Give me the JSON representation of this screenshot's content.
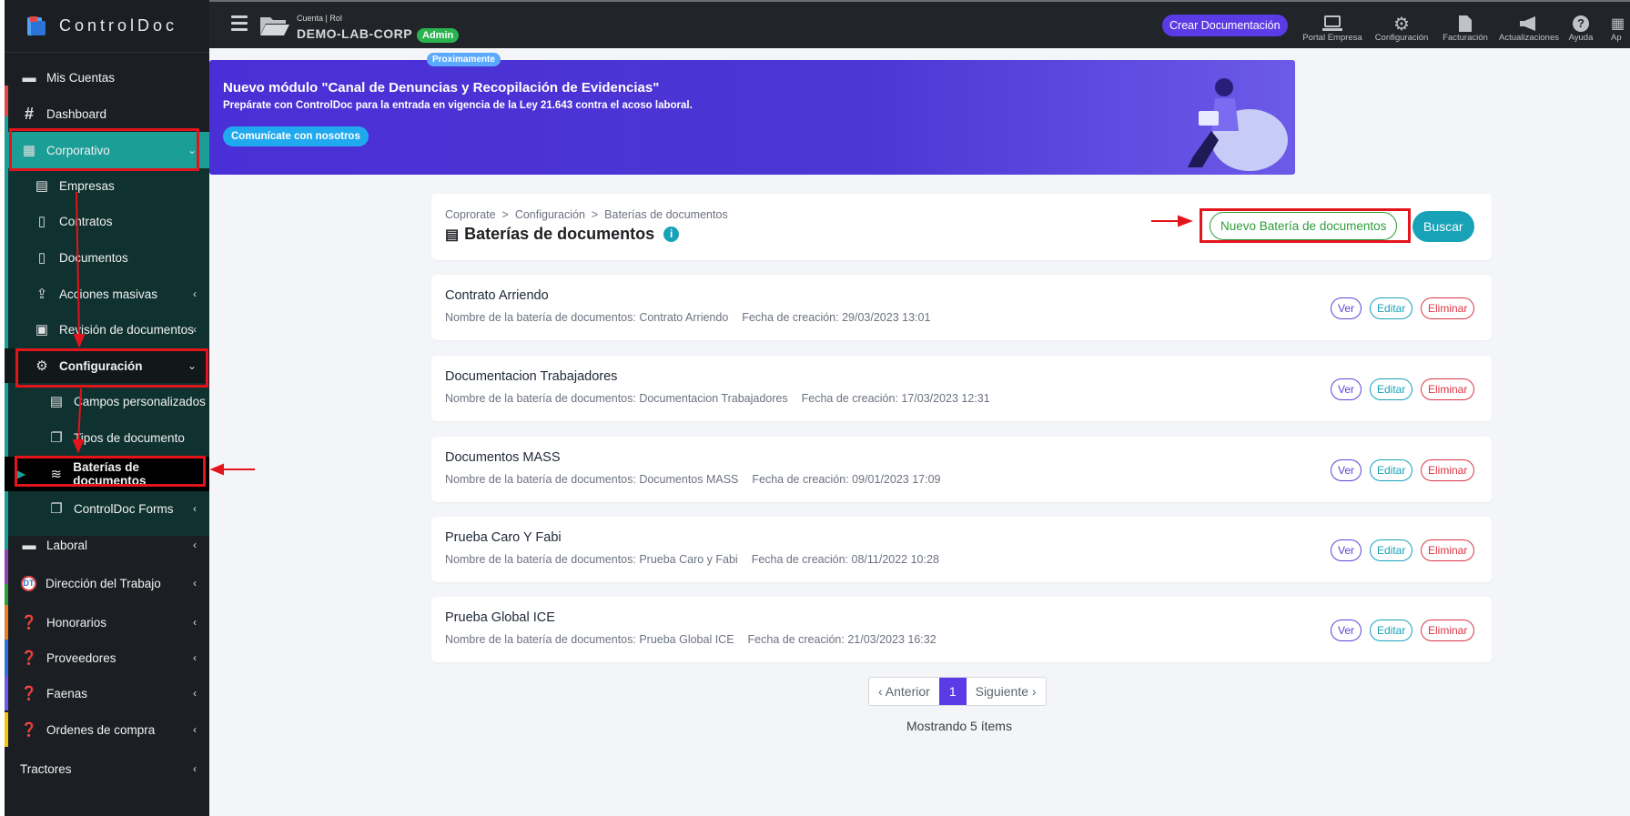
{
  "brand": {
    "name": "ControlDoc"
  },
  "topbar": {
    "account_small": "Cuenta | Rol",
    "account_name": "DEMO-LAB-CORP",
    "role_badge": "Admin",
    "create_button": "Crear Documentación",
    "tools": [
      {
        "label": "Portal Empresa",
        "icon": "laptop-icon"
      },
      {
        "label": "Configuración",
        "icon": "gears-icon"
      },
      {
        "label": "Facturación",
        "icon": "invoice-icon"
      },
      {
        "label": "Actualizaciones",
        "icon": "megaphone-icon"
      },
      {
        "label": "Ayuda",
        "icon": "help-icon"
      },
      {
        "label": "Ap",
        "icon": "apps-icon"
      }
    ]
  },
  "sidebar": {
    "items": [
      {
        "label": "Mis Cuentas",
        "icon": "folder-icon"
      },
      {
        "label": "Dashboard",
        "icon": "hash-icon"
      },
      {
        "label": "Corporativo",
        "icon": "building-icon"
      },
      {
        "label": "Empresas",
        "icon": "building-small-icon"
      },
      {
        "label": "Contratos",
        "icon": "file-contract-icon"
      },
      {
        "label": "Documentos",
        "icon": "file-icon"
      },
      {
        "label": "Acciones masivas",
        "icon": "upload-icon"
      },
      {
        "label": "Revisión de documentos",
        "icon": "clipboard-check-icon"
      },
      {
        "label": "Configuración",
        "icon": "gears-icon"
      },
      {
        "label": "Campos personalizados",
        "icon": "form-icon"
      },
      {
        "label": "Tipos de documento",
        "icon": "copy-icon"
      },
      {
        "label": "Baterías de documentos",
        "icon": "layers-icon"
      },
      {
        "label": "ControlDoc Forms",
        "icon": "forms-icon"
      },
      {
        "label": "Laboral",
        "icon": "briefcase-icon"
      },
      {
        "label": "Dirección del Trabajo",
        "icon": "dt-icon"
      },
      {
        "label": "Honorarios",
        "icon": "question-icon"
      },
      {
        "label": "Proveedores",
        "icon": "question-icon"
      },
      {
        "label": "Faenas",
        "icon": "question-icon"
      },
      {
        "label": "Ordenes de compra",
        "icon": "question-icon"
      },
      {
        "label": "Tractores",
        "icon": ""
      }
    ],
    "dt_badge": "DT"
  },
  "banner": {
    "badge": "Proximamente",
    "title": "Nuevo módulo \"Canal de Denuncias y Recopilación de Evidencias\"",
    "subtitle": "Prepárate con ControlDoc para la entrada en vigencia de la Ley 21.643 contra el acoso laboral.",
    "button": "Comunícate con nosotros"
  },
  "header_card": {
    "breadcrumb": [
      "Coprorate",
      "Configuración",
      "Baterías de documentos"
    ],
    "breadcrumb_sep": ">",
    "title": "Baterías de documentos",
    "new_button": "Nuevo Batería de documentos",
    "search_button": "Buscar"
  },
  "rows": [
    {
      "title": "Contrato Arriendo",
      "name_label": "Nombre de la batería de documentos: Contrato Arriendo",
      "date_label": "Fecha de creación: 29/03/2023 13:01"
    },
    {
      "title": "Documentacion Trabajadores",
      "name_label": "Nombre de la batería de documentos: Documentacion Trabajadores",
      "date_label": "Fecha de creación: 17/03/2023 12:31"
    },
    {
      "title": "Documentos MASS",
      "name_label": "Nombre de la batería de documentos: Documentos MASS",
      "date_label": "Fecha de creación: 09/01/2023 17:09"
    },
    {
      "title": "Prueba Caro Y Fabi",
      "name_label": "Nombre de la batería de documentos: Prueba Caro y Fabi",
      "date_label": "Fecha de creación: 08/11/2022 10:28"
    },
    {
      "title": "Prueba Global ICE",
      "name_label": "Nombre de la batería de documentos: Prueba Global ICE",
      "date_label": "Fecha de creación: 21/03/2023 16:32"
    }
  ],
  "row_actions": {
    "view": "Ver",
    "edit": "Editar",
    "delete": "Eliminar"
  },
  "pagination": {
    "prev": "‹ Anterior",
    "current": "1",
    "next": "Siguiente ›",
    "summary": "Mostrando 5 ítems"
  },
  "colors": {
    "sidebar": "#1b1f24",
    "active_teal": "#1a9e96",
    "accent_purple": "#5b3be6",
    "annotation_red": "#e3141b"
  }
}
